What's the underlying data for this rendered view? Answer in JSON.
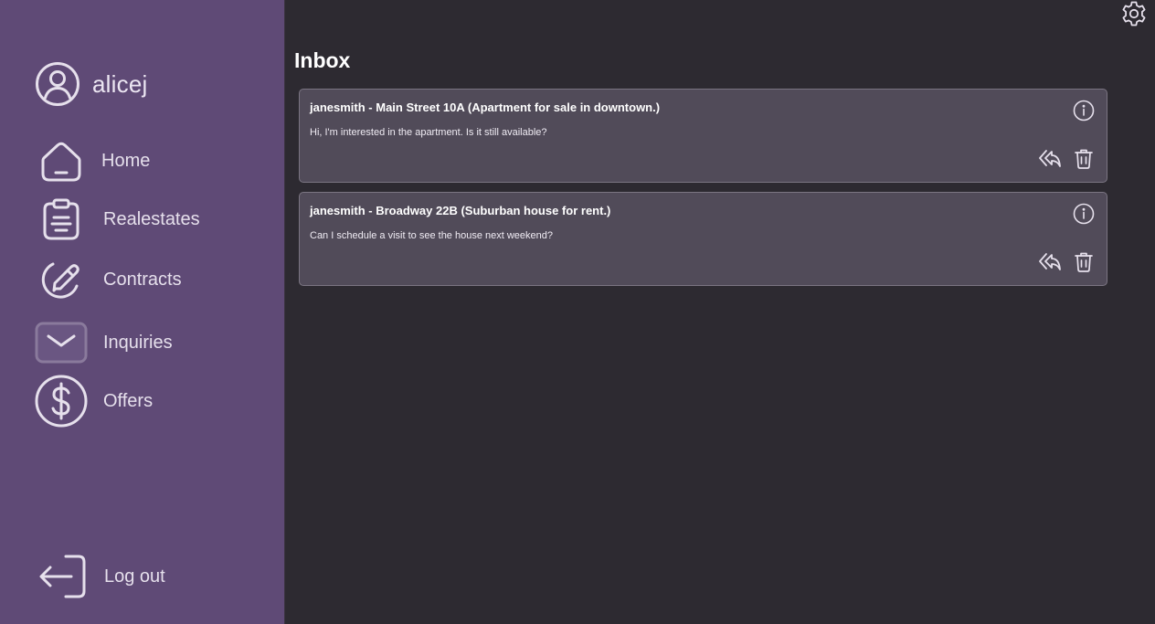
{
  "user": {
    "username": "alicej",
    "avatar_icon": "user-circle-icon"
  },
  "nav": {
    "items": [
      {
        "label": "Home",
        "icon": "home-icon"
      },
      {
        "label": "Realestates",
        "icon": "clipboard-icon"
      },
      {
        "label": "Contracts",
        "icon": "pen-circle-icon"
      },
      {
        "label": "Inquiries",
        "icon": "mail-icon",
        "active": true
      },
      {
        "label": "Offers",
        "icon": "dollar-circle-icon"
      }
    ],
    "logout_label": "Log out"
  },
  "page": {
    "title": "Inbox",
    "settings_icon": "gear-icon"
  },
  "messages": [
    {
      "title": "janesmith - Main Street 10A (Apartment for sale in downtown.)",
      "body": "Hi, I'm interested in the apartment. Is it still available?"
    },
    {
      "title": "janesmith - Broadway 22B (Suburban house for rent.)",
      "body": "Can I schedule a visit to see the house next weekend?"
    }
  ],
  "colors": {
    "sidebar": "#5f4a76",
    "background": "#2d2a31",
    "card": "#514b59",
    "card_border": "#7b7582"
  }
}
